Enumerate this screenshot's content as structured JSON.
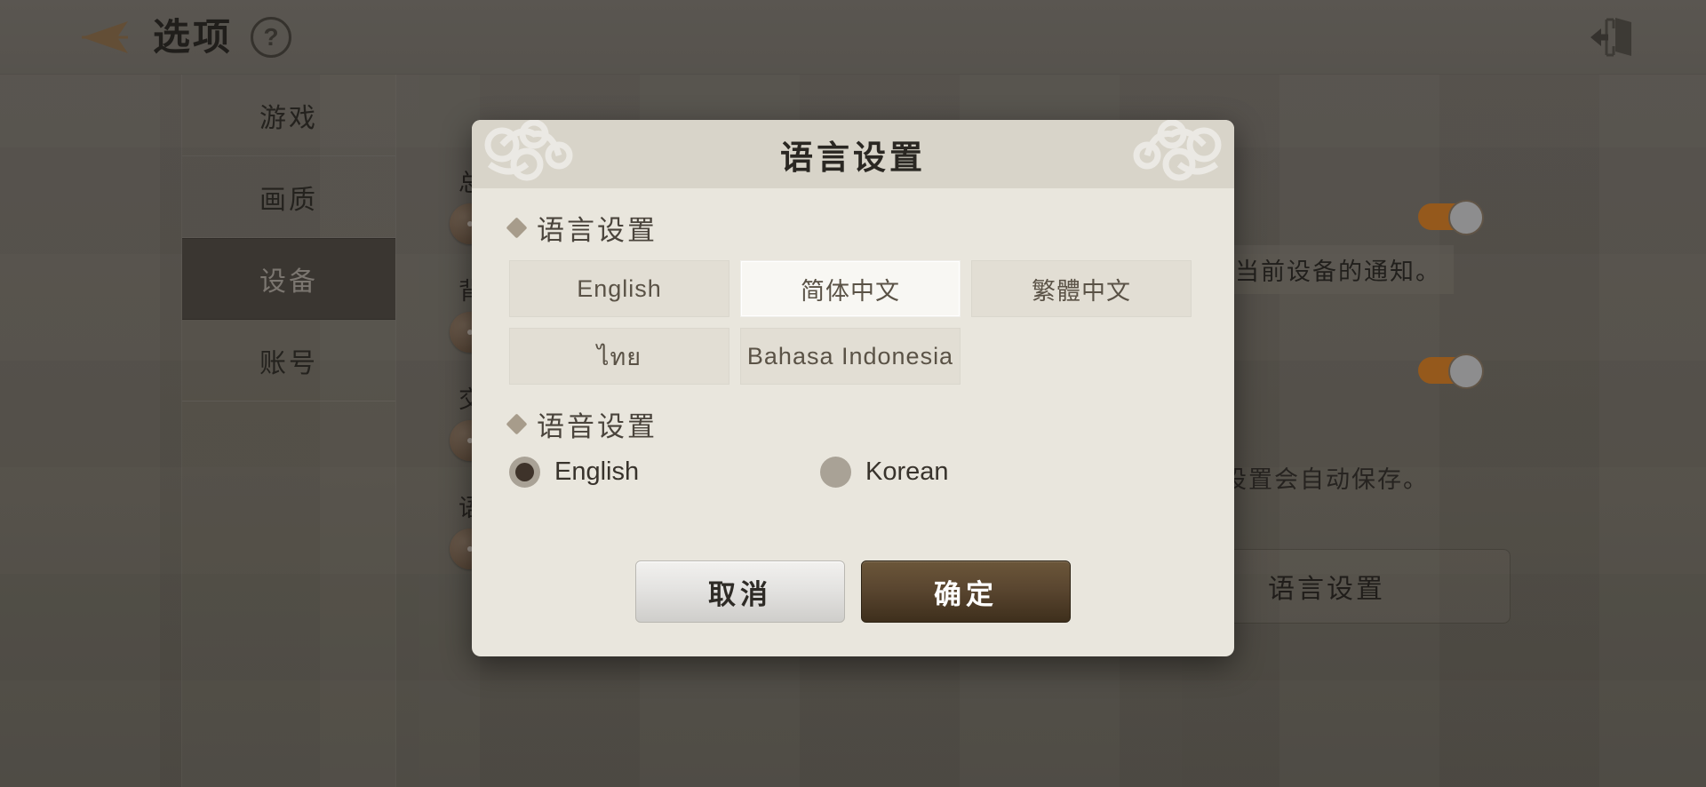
{
  "header": {
    "title": "选项",
    "help_label": "?",
    "back_icon": "back-arrow-icon",
    "exit_icon": "exit-door-icon"
  },
  "sidebar": {
    "items": [
      {
        "label": "游戏",
        "selected": false
      },
      {
        "label": "画质",
        "selected": false
      },
      {
        "label": "设备",
        "selected": true
      },
      {
        "label": "账号",
        "selected": false
      }
    ]
  },
  "background_panel": {
    "row_labels": [
      "总",
      "背",
      "交",
      "语"
    ],
    "tip_text": "当前设备的通知。",
    "autosave_note": "设置会自动保存。",
    "language_button": "语言设置",
    "toggles": [
      {
        "state": "on",
        "color": "#c4701a"
      },
      {
        "state": "on",
        "color": "#c4701a"
      }
    ]
  },
  "dialog": {
    "title": "语言设置",
    "language_section": {
      "heading": "语言设置",
      "options": [
        {
          "label": "English",
          "selected": false
        },
        {
          "label": "简体中文",
          "selected": true
        },
        {
          "label": "繁體中文",
          "selected": false
        },
        {
          "label": "ไทย",
          "selected": false
        },
        {
          "label": "Bahasa Indonesia",
          "selected": false
        }
      ]
    },
    "voice_section": {
      "heading": "语音设置",
      "options": [
        {
          "label": "English",
          "selected": true
        },
        {
          "label": "Korean",
          "selected": false
        }
      ]
    },
    "actions": {
      "cancel": "取消",
      "confirm": "确定"
    }
  },
  "colors": {
    "accent_orange": "#c4701a",
    "dialog_bg": "#e9e6dd",
    "title_bar": "#d8d4c9",
    "confirm_brown": "#5a4630",
    "selected_sidebar": "#433e38"
  }
}
